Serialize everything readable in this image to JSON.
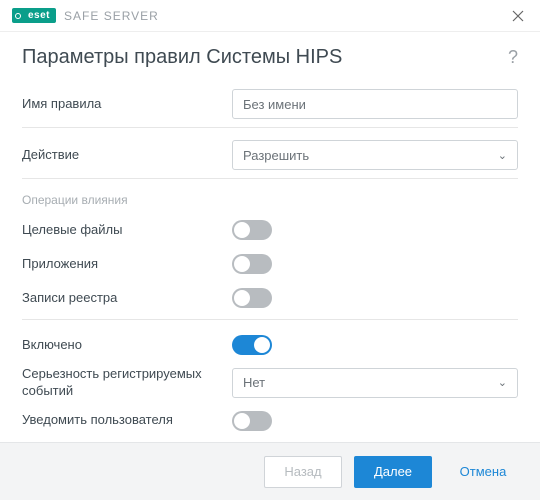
{
  "titlebar": {
    "brand_badge": "eset",
    "app_name": "SAFE SERVER"
  },
  "dialog": {
    "title": "Параметры правил Системы HIPS"
  },
  "fields": {
    "rule_name_label": "Имя правила",
    "rule_name_value": "Без имени",
    "action_label": "Действие",
    "action_value": "Разрешить"
  },
  "ops_section": {
    "heading": "Операции влияния",
    "target_files_label": "Целевые файлы",
    "target_files_on": false,
    "applications_label": "Приложения",
    "applications_on": false,
    "registry_label": "Записи реестра",
    "registry_on": false
  },
  "misc": {
    "enabled_label": "Включено",
    "enabled_on": true,
    "severity_label": "Серьезность регистрируемых событий",
    "severity_value": "Нет",
    "notify_label": "Уведомить пользователя",
    "notify_on": false
  },
  "footer": {
    "back": "Назад",
    "next": "Далее",
    "cancel": "Отмена"
  }
}
